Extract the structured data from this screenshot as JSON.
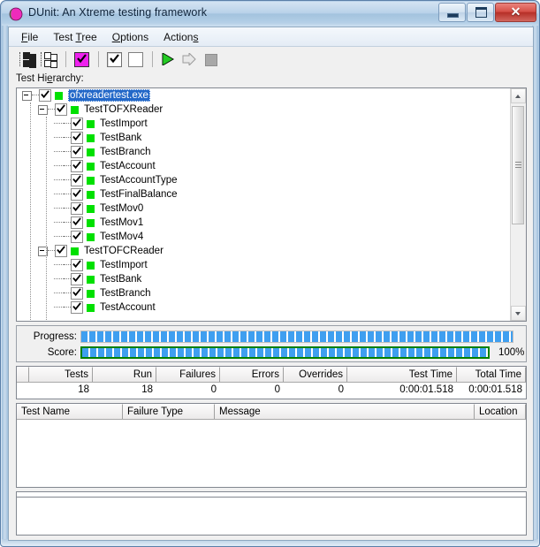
{
  "window": {
    "title": "DUnit: An Xtreme testing framework",
    "icon": "dunit-logo-icon",
    "controls": {
      "minimize": "minimize-button",
      "maximize": "maximize-button",
      "close_glyph": "✕"
    }
  },
  "menubar": {
    "items": [
      {
        "pre": "",
        "accel": "F",
        "post": "ile"
      },
      {
        "pre": "Test ",
        "accel": "T",
        "post": "ree"
      },
      {
        "pre": "",
        "accel": "O",
        "post": "ptions"
      },
      {
        "pre": "Action",
        "accel": "s",
        "post": ""
      }
    ]
  },
  "toolbar": {
    "buttons": [
      {
        "name": "select-all-nodes-button",
        "icon": "nodes-select-all-icon"
      },
      {
        "name": "deselect-all-nodes-button",
        "icon": "nodes-deselect-all-icon"
      },
      {
        "name": "select-failed-tests-button",
        "icon": "magenta-check-icon"
      },
      {
        "name": "check-all-button",
        "icon": "checkbox-checked-icon"
      },
      {
        "name": "uncheck-all-button",
        "icon": "checkbox-empty-icon"
      },
      {
        "name": "run-button",
        "icon": "run-green-arrow-icon"
      },
      {
        "name": "step-button",
        "icon": "step-arrow-icon"
      },
      {
        "name": "stop-button",
        "icon": "stop-square-icon"
      }
    ]
  },
  "hierarchy": {
    "label_pre": "Test Hi",
    "label_accel": "e",
    "label_post": "rarchy:",
    "nodes": [
      {
        "depth": 0,
        "expander": true,
        "label": "ofxreadertest.exe",
        "selected": true,
        "checked": true,
        "status": "pass"
      },
      {
        "depth": 1,
        "expander": true,
        "label": "TestTOFXReader",
        "selected": false,
        "checked": true,
        "status": "pass"
      },
      {
        "depth": 2,
        "expander": false,
        "label": "TestImport",
        "selected": false,
        "checked": true,
        "status": "pass"
      },
      {
        "depth": 2,
        "expander": false,
        "label": "TestBank",
        "selected": false,
        "checked": true,
        "status": "pass"
      },
      {
        "depth": 2,
        "expander": false,
        "label": "TestBranch",
        "selected": false,
        "checked": true,
        "status": "pass"
      },
      {
        "depth": 2,
        "expander": false,
        "label": "TestAccount",
        "selected": false,
        "checked": true,
        "status": "pass"
      },
      {
        "depth": 2,
        "expander": false,
        "label": "TestAccountType",
        "selected": false,
        "checked": true,
        "status": "pass"
      },
      {
        "depth": 2,
        "expander": false,
        "label": "TestFinalBalance",
        "selected": false,
        "checked": true,
        "status": "pass"
      },
      {
        "depth": 2,
        "expander": false,
        "label": "TestMov0",
        "selected": false,
        "checked": true,
        "status": "pass"
      },
      {
        "depth": 2,
        "expander": false,
        "label": "TestMov1",
        "selected": false,
        "checked": true,
        "status": "pass"
      },
      {
        "depth": 2,
        "expander": false,
        "label": "TestMov4",
        "selected": false,
        "checked": true,
        "status": "pass"
      },
      {
        "depth": 1,
        "expander": true,
        "label": "TestTOFCReader",
        "selected": false,
        "checked": true,
        "status": "pass"
      },
      {
        "depth": 2,
        "expander": false,
        "label": "TestImport",
        "selected": false,
        "checked": true,
        "status": "pass"
      },
      {
        "depth": 2,
        "expander": false,
        "label": "TestBank",
        "selected": false,
        "checked": true,
        "status": "pass"
      },
      {
        "depth": 2,
        "expander": false,
        "label": "TestBranch",
        "selected": false,
        "checked": true,
        "status": "pass"
      },
      {
        "depth": 2,
        "expander": false,
        "label": "TestAccount",
        "selected": false,
        "checked": true,
        "status": "pass"
      }
    ]
  },
  "progress": {
    "progress_label": "Progress:",
    "progress_percent": 100,
    "score_label": "Score:",
    "score_percent": 100,
    "score_text": "100%",
    "bar_color": "#3f9ff0",
    "score_border_color": "#008000"
  },
  "stats": {
    "headers": [
      "Tests",
      "Run",
      "Failures",
      "Errors",
      "Overrides",
      "Test Time",
      "Total Time"
    ],
    "row": [
      "18",
      "18",
      "0",
      "0",
      "0",
      "0:00:01.518",
      "0:00:01.518"
    ]
  },
  "failures": {
    "headers": [
      "Test Name",
      "Failure Type",
      "Message",
      "Location"
    ],
    "rows": []
  }
}
